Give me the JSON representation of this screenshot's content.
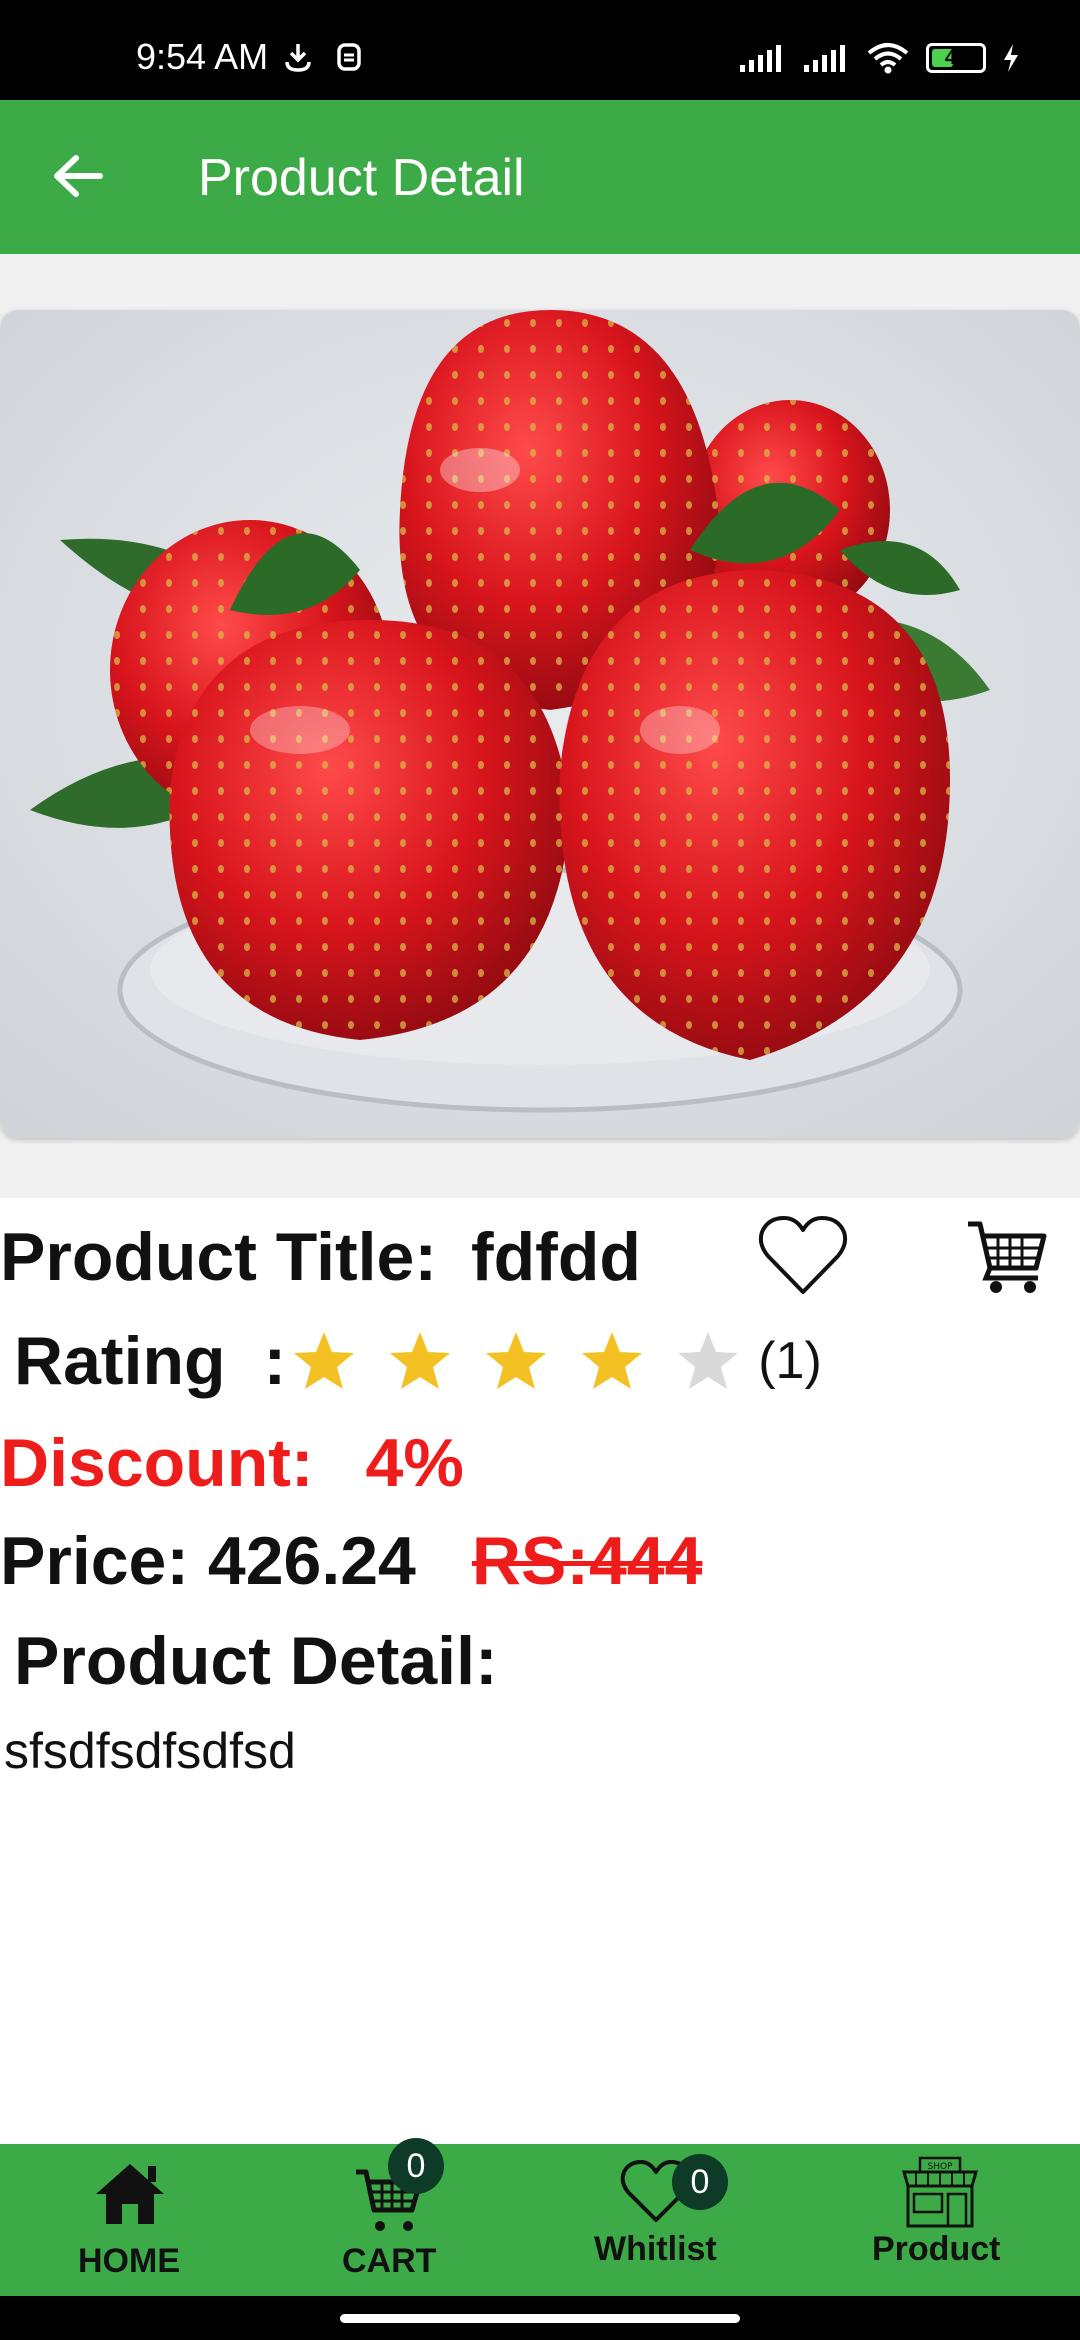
{
  "status_bar": {
    "time": "9:54 AM",
    "battery": "44",
    "battery_level": 0.44,
    "icons": [
      "download-icon",
      "notification-icon",
      "signal-icon",
      "signal-icon",
      "wifi-icon",
      "battery-icon",
      "charging-icon"
    ]
  },
  "app_bar": {
    "title": "Product Detail",
    "back_icon": "arrow-left-icon",
    "color": "#3cab47"
  },
  "product": {
    "image": "strawberries-photo",
    "title_label": "Product Title:",
    "title_value": "fdfdd",
    "rating_label": "Rating",
    "rating_colon": ":",
    "rating_value": 4,
    "rating_max": 5,
    "rating_count": "(1)",
    "discount_label": "Discount:",
    "discount_value": "4%",
    "price_label": "Price: 426.24",
    "price_old": "RS:444",
    "detail_heading": "Product Detail:",
    "detail_text": "sfsdfsdfsdfsd",
    "accent_red": "#ef1c1c",
    "star_color": "#f4c124"
  },
  "bottom_nav": {
    "items": [
      {
        "label": "HOME",
        "icon": "home-icon"
      },
      {
        "label": "CART",
        "icon": "cart-icon",
        "badge": "0"
      },
      {
        "label": "Whitlist",
        "icon": "heart-icon",
        "badge": "0"
      },
      {
        "label": "Product",
        "icon": "shop-icon"
      }
    ]
  }
}
